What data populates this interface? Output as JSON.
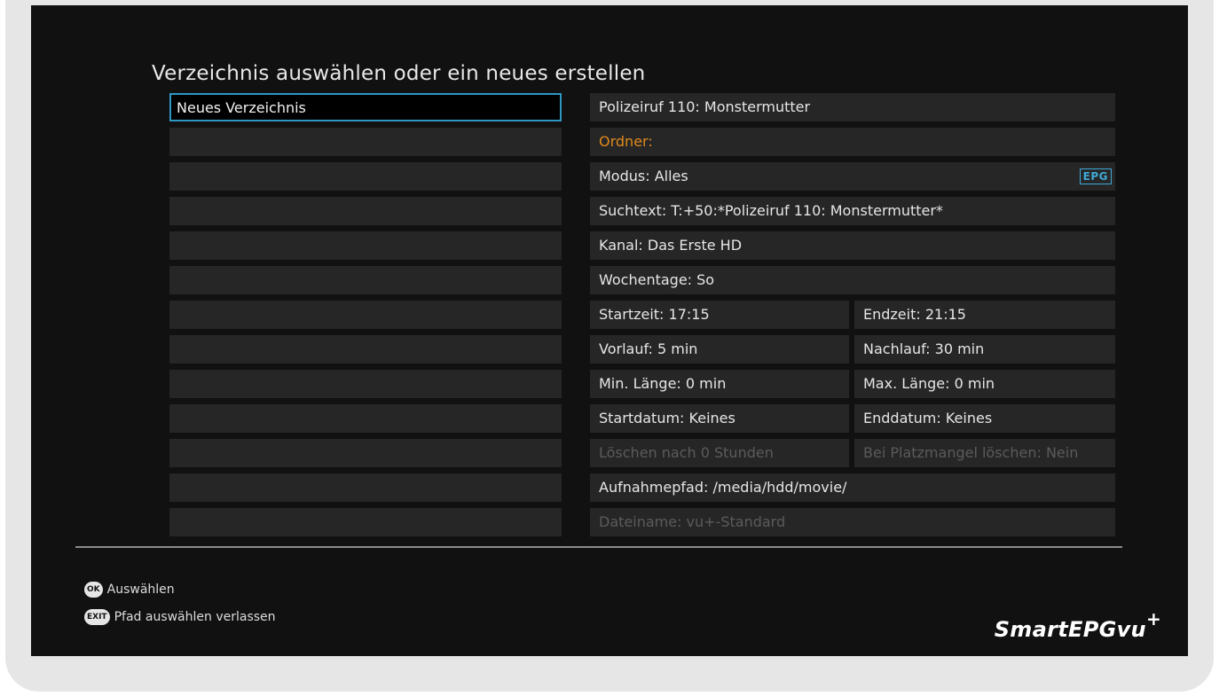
{
  "title": "Verzeichnis auswählen oder ein neues erstellen",
  "left_list": {
    "items": [
      "Neues Verzeichnis",
      "",
      "",
      "",
      "",
      "",
      "",
      "",
      "",
      "",
      "",
      "",
      ""
    ],
    "selected_index": 0
  },
  "details": {
    "name": "Polizeiruf 110: Monstermutter",
    "ordner": "Ordner:",
    "modus": "Modus: Alles",
    "epg_badge": "EPG",
    "suchtext": "Suchtext: T:+50:*Polizeiruf 110: Monstermutter*",
    "kanal": "Kanal: Das Erste HD",
    "wochentage": "Wochentage:  So",
    "startzeit": "Startzeit: 17:15",
    "endzeit": "Endzeit: 21:15",
    "vorlauf": "Vorlauf: 5 min",
    "nachlauf": "Nachlauf: 30 min",
    "min_laenge": "Min. Länge: 0 min",
    "max_laenge": "Max. Länge: 0 min",
    "startdatum": "Startdatum: Keines",
    "enddatum": "Enddatum: Keines",
    "loeschen_nach": "Löschen nach 0 Stunden",
    "platzmangel": "Bei Platzmangel löschen: Nein",
    "aufnahmepfad": "Aufnahmepfad: /media/hdd/movie/",
    "dateiname": "Dateiname: vu+-Standard"
  },
  "hints": {
    "ok_key": "OK",
    "ok_label": "Auswählen",
    "exit_key": "EXIT",
    "exit_label": "Pfad auswählen verlassen"
  },
  "logo": {
    "text": "SmartEPGvu",
    "plus": "+"
  },
  "colors": {
    "accent": "#2e97c4",
    "orange": "#e08a1e",
    "background": "#111111",
    "row": "#262626"
  }
}
